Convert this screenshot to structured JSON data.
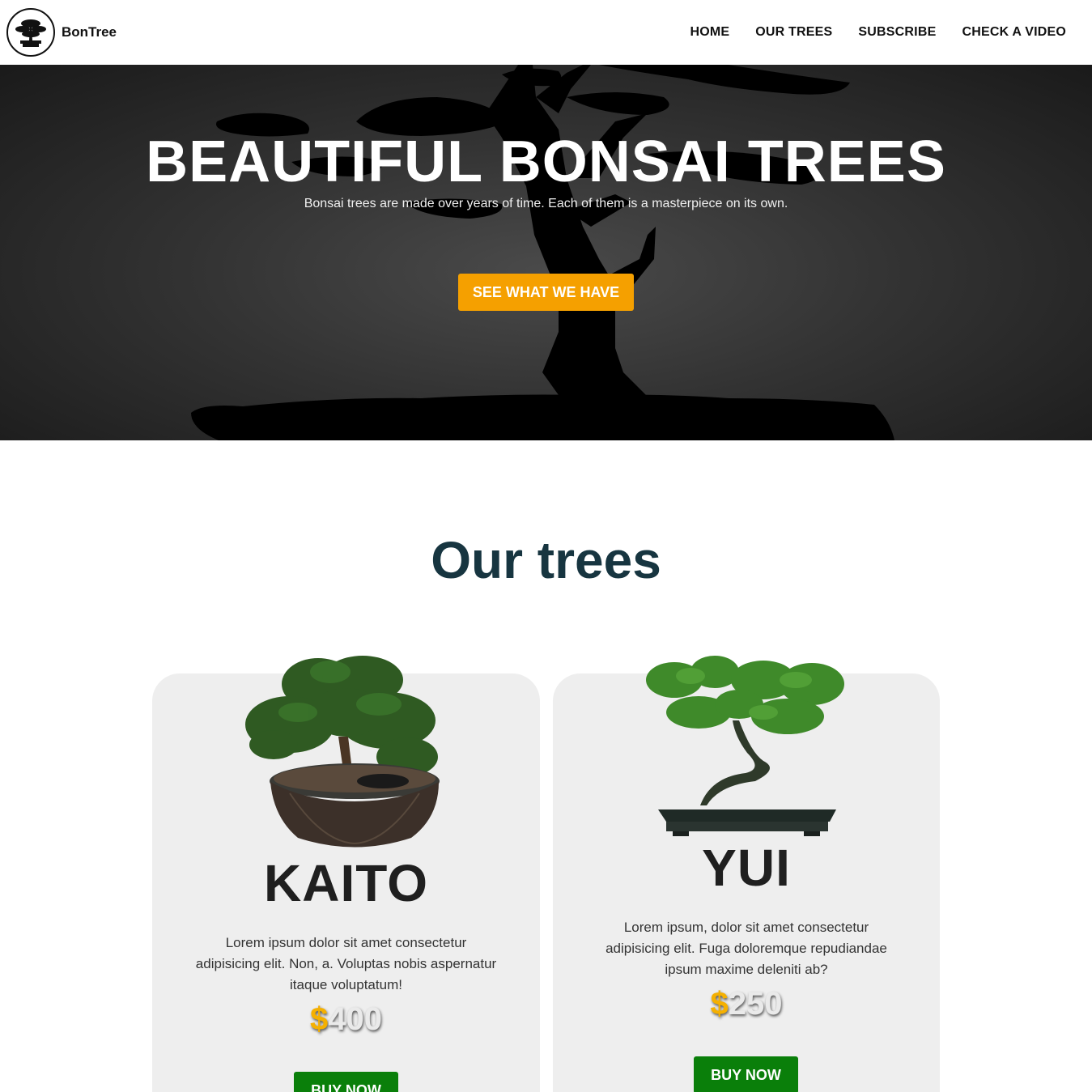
{
  "brand": {
    "name": "BonTree",
    "logo_icon": "bonsai-logo-icon"
  },
  "nav": {
    "items": [
      {
        "label": "HOME"
      },
      {
        "label": "OUR TREES"
      },
      {
        "label": "SUBSCRIBE"
      },
      {
        "label": "CHECK A VIDEO"
      }
    ]
  },
  "hero": {
    "title": "BEAUTIFUL BONSAI TREES",
    "subtitle": "Bonsai trees are made over years of time. Each of them is a masterpiece on its own.",
    "cta_label": "SEE WHAT WE HAVE"
  },
  "section": {
    "title": "Our trees"
  },
  "products": [
    {
      "name": "KAITO",
      "description": "Lorem ipsum dolor sit amet consectetur adipisicing elit. Non, a. Voluptas nobis aspernatur itaque voluptatum!",
      "currency": "$",
      "price": "400",
      "button_label": "BUY NOW"
    },
    {
      "name": "YUI",
      "description": "Lorem ipsum, dolor sit amet consectetur adipisicing elit. Fuga doloremque repudiandae ipsum maxime deleniti ab?",
      "currency": "$",
      "price": "250",
      "button_label": "BUY NOW"
    }
  ],
  "colors": {
    "accent": "#f5a000",
    "buy_button": "#0a7f0a",
    "section_title": "#173540",
    "card_bg": "#eeeeee",
    "price_currency": "#f5b000"
  }
}
